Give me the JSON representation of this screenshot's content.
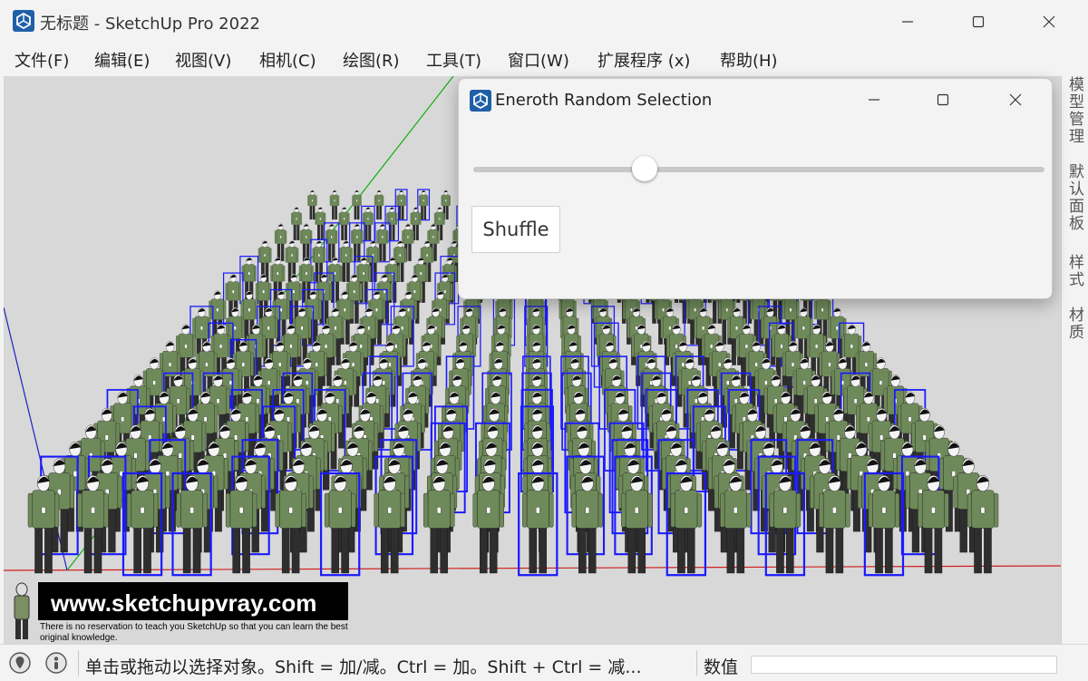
{
  "window": {
    "title": "无标题 - SketchUp Pro 2022",
    "icons": {
      "app": "sketchup-logo-icon",
      "minimize": "minimize-icon",
      "maximize": "maximize-icon",
      "close": "close-icon"
    }
  },
  "menu": {
    "items": [
      {
        "label": "文件(F)"
      },
      {
        "label": "编辑(E)"
      },
      {
        "label": "视图(V)"
      },
      {
        "label": "相机(C)"
      },
      {
        "label": "绘图(R)"
      },
      {
        "label": "工具(T)"
      },
      {
        "label": "窗口(W)"
      },
      {
        "label": "扩展程序 (x)"
      },
      {
        "label": "帮助(H)"
      }
    ]
  },
  "tray": {
    "tabs": [
      {
        "label": "模型管理"
      },
      {
        "label": "默认面板"
      },
      {
        "label": "样式"
      },
      {
        "label": "材质"
      }
    ]
  },
  "dialog": {
    "title": "Eneroth Random Selection",
    "slider_value": 0.3,
    "shuffle_label": "Shuffle"
  },
  "watermark": {
    "url": "www.sketchupvray.com",
    "tagline": "There is no reservation to teach you SketchUp so that you can learn the best original knowledge."
  },
  "statusbar": {
    "message": "单击或拖动以选择对象。Shift = 加/减。Ctrl = 加。Shift + Ctrl = 减...",
    "measurements_label": "数值",
    "measurements_value": "",
    "icons": [
      "geo-location-icon",
      "instructor-icon"
    ]
  },
  "scene": {
    "colors": {
      "sky": "#d8d8d8",
      "selection": "#1a1aff",
      "shirt": "#6f8a5a",
      "trousers": "#2e2e2e",
      "red_axis": "#d02020",
      "green_axis": "#10b010",
      "blue_axis": "#2020c0"
    }
  }
}
